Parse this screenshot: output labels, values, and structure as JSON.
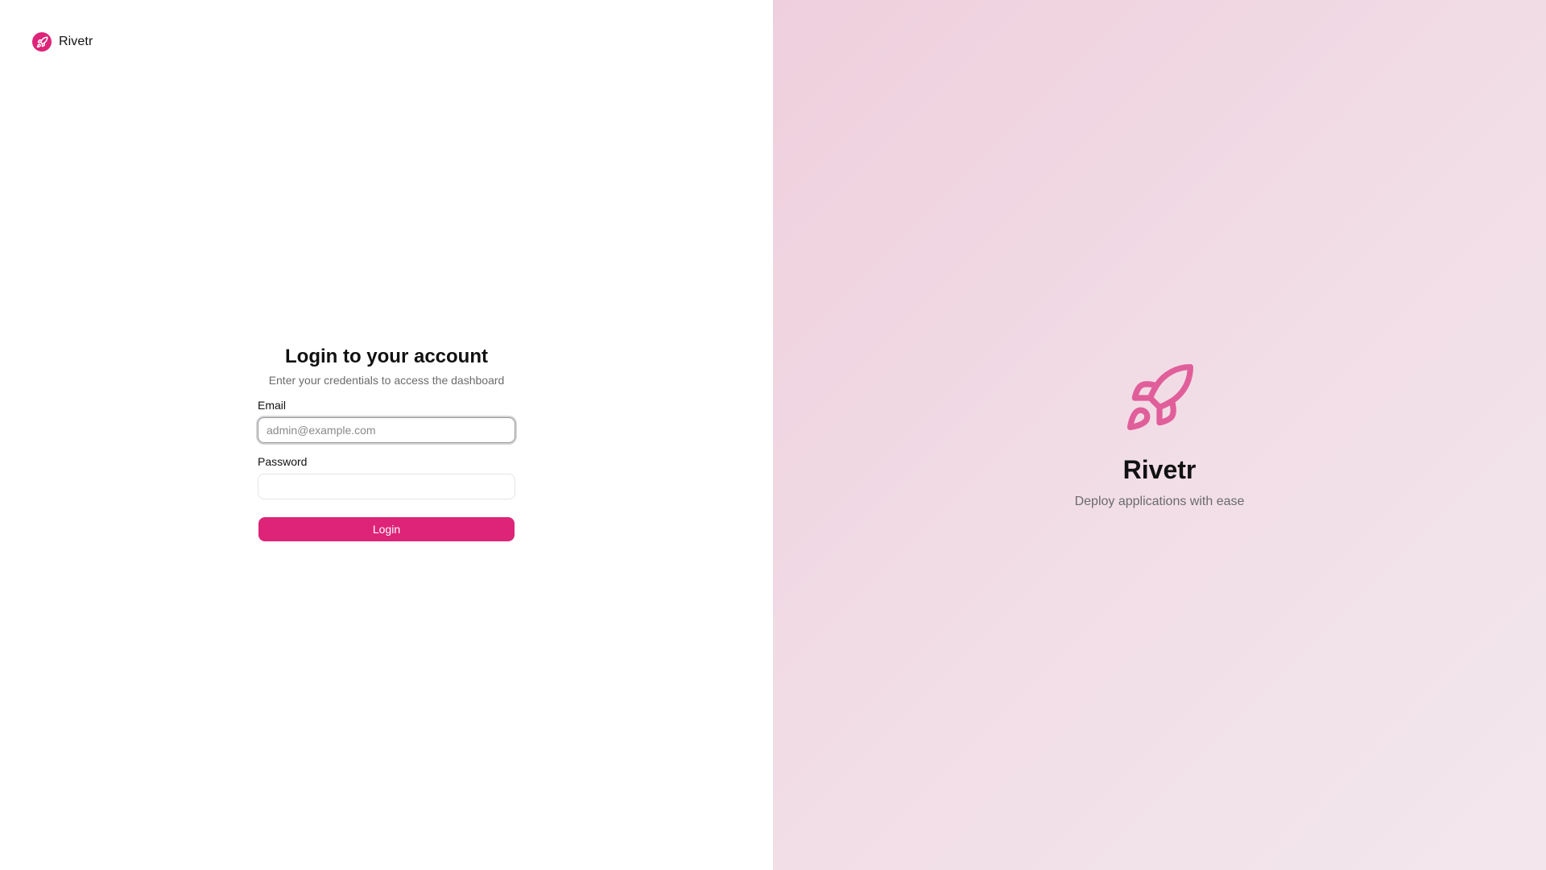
{
  "brand": {
    "name": "Rivetr",
    "logo_icon": "rocket-icon",
    "accent_color": "#dd2478"
  },
  "login": {
    "title": "Login to your account",
    "subtitle": "Enter your credentials to access the dashboard",
    "email_label": "Email",
    "email_placeholder": "admin@example.com",
    "email_value": "",
    "password_label": "Password",
    "password_value": "",
    "submit_label": "Login"
  },
  "hero": {
    "icon": "rocket-icon",
    "title": "Rivetr",
    "subtitle": "Deploy applications with ease",
    "background_color": "#f1dde6"
  }
}
